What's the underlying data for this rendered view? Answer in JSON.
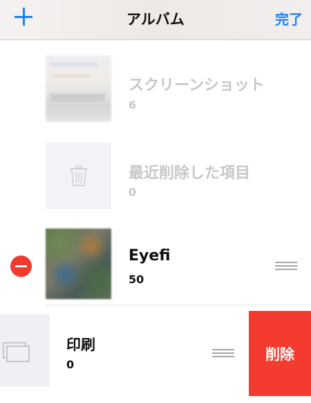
{
  "nav": {
    "title": "アルバム",
    "done_label": "完了"
  },
  "albums": [
    {
      "title": "スクリーンショット",
      "count": "6"
    },
    {
      "title": "最近削除した項目",
      "count": "0"
    },
    {
      "title": "Eyefi",
      "count": "50"
    },
    {
      "title": "印刷",
      "count": "0"
    }
  ],
  "swipe_action": {
    "delete_label": "削除"
  },
  "colors": {
    "accent": "#1a82fb",
    "delete_red": "#f43b30",
    "faded_text": "#c7c7c7"
  },
  "icons": {
    "add": "plus-icon",
    "trash": "trash-icon",
    "delete": "minus-circle-icon",
    "reorder": "reorder-handle-icon",
    "print_album": "stacked-albums-icon"
  }
}
